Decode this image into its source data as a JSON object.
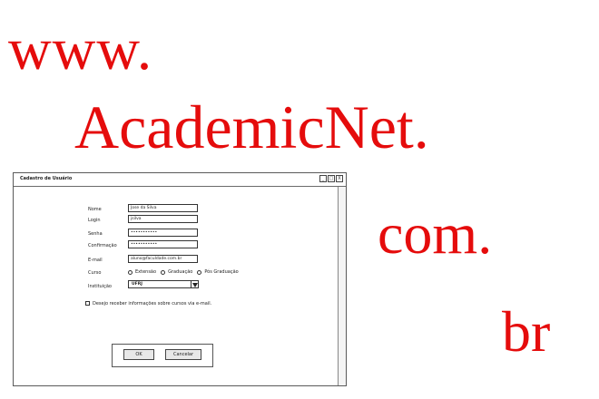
{
  "banner": {
    "line1": "www.",
    "line2": "AcademicNet.",
    "line3": "com.",
    "line4": "br"
  },
  "window": {
    "title": "Cadastro de Usuário",
    "controls": [
      "_",
      "□",
      "X"
    ]
  },
  "form": {
    "nome": {
      "label": "Nome",
      "value": "Jose da Silva"
    },
    "login": {
      "label": "Login",
      "value": "jsilva"
    },
    "senha": {
      "label": "Senha",
      "value": "•••••••••••"
    },
    "confirmacao": {
      "label": "Confirmação",
      "value": "•••••••••••"
    },
    "email": {
      "label": "E-mail",
      "value": "aluno@faculdade.com.br"
    },
    "curso": {
      "label": "Curso",
      "options": [
        "Extensão",
        "Graduação",
        "Pós Graduação"
      ]
    },
    "instituicao": {
      "label": "Instituição",
      "value": "UFRJ"
    },
    "newsletter": {
      "label": "Desejo receber informações sobre cursos via e-mail."
    }
  },
  "buttons": {
    "ok": "OK",
    "cancel": "Cancelar"
  }
}
